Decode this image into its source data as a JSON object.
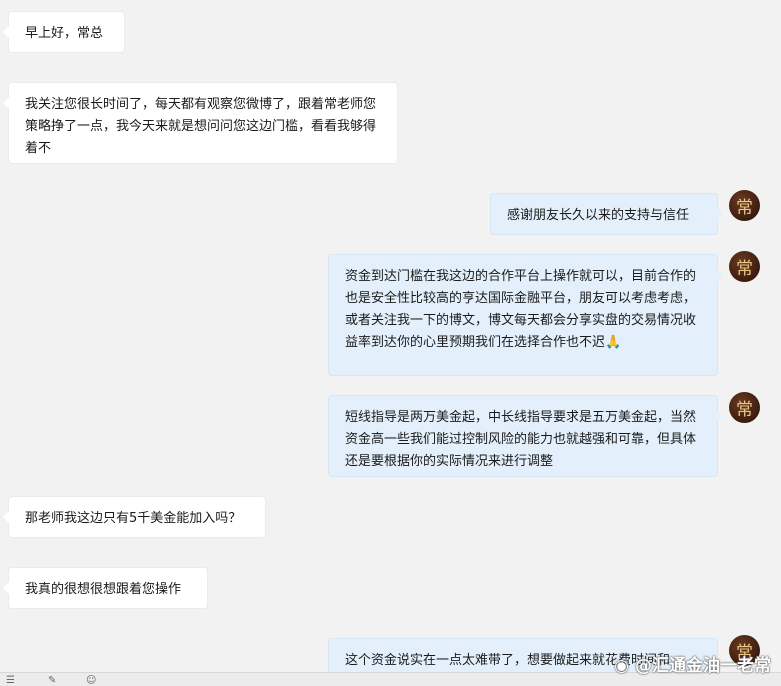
{
  "messages": [
    {
      "side": "left",
      "text": "早上好，常总"
    },
    {
      "side": "left",
      "text": "我关注您很长时间了，每天都有观察您微博了，跟着常老师您策略挣了一点，我今天来就是想问问您这边门槛，看看我够得着不"
    },
    {
      "side": "right",
      "text": "感谢朋友长久以来的支持与信任"
    },
    {
      "side": "right",
      "text": "资金到达门槛在我这边的合作平台上操作就可以，目前合作的也是安全性比较高的亨达国际金融平台，朋友可以考虑考虑，或者关注我一下的博文，博文每天都会分享实盘的交易情况收益率到达你的心里预期我们在选择合作也不迟🙏"
    },
    {
      "side": "right",
      "text": "短线指导是两万美金起，中长线指导要求是五万美金起，当然资金高一些我们能过控制风险的能力也就越强和可靠，但具体还是要根据你的实际情况来进行调整"
    },
    {
      "side": "left",
      "text": "那老师我这边只有5千美金能加入吗？"
    },
    {
      "side": "left",
      "text": "我真的很想很想跟着您操作"
    },
    {
      "side": "right",
      "text": "这个资金说实在一点太难带了，想要做起来就花费时间和"
    }
  ],
  "avatar": {
    "char": "常"
  },
  "watermark": {
    "text": "@汇通金油一老常",
    "icon": "weibo-icon"
  },
  "colors": {
    "left_bubble": "#ffffff",
    "right_bubble": "#e3f0fb",
    "avatar": "#3a1c0e"
  }
}
